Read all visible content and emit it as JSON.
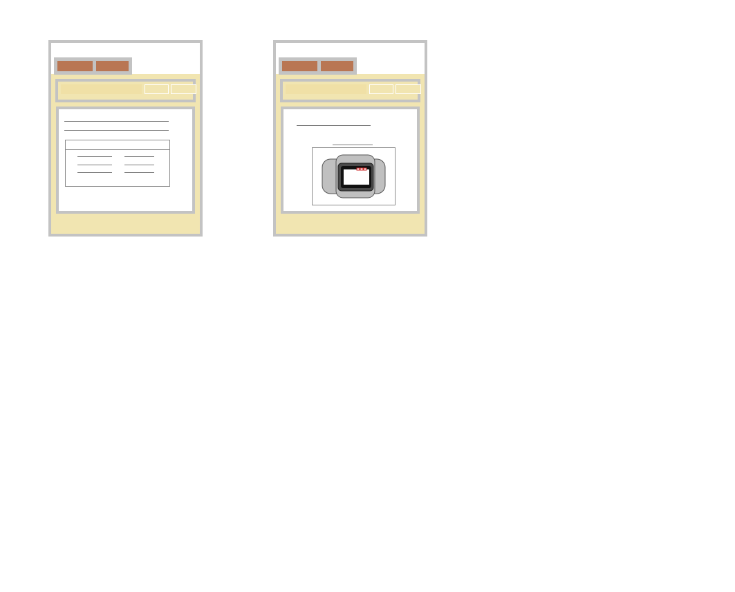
{
  "figure": {
    "left_panel": {
      "tabs": [
        "",
        ""
      ],
      "toolbar": {
        "field": "",
        "boxes": [
          "",
          ""
        ]
      },
      "content": {
        "text_lines": 2,
        "table": {
          "header_rows": 1,
          "rows": 3,
          "columns": 2
        }
      }
    },
    "right_panel": {
      "tabs": [
        "",
        ""
      ],
      "toolbar": {
        "field": "",
        "boxes": [
          "",
          ""
        ]
      },
      "content": {
        "text_lines": 2,
        "device_illustration": {
          "controls_color": "#cc2222",
          "controls_count": 3
        }
      }
    },
    "colors": {
      "frame_gray": "#c3c3c3",
      "panel_tan": "#f1e5b1",
      "tab_brown": "#b97653",
      "device_gray": "#c0c0c0",
      "device_dark": "#4a4a4a"
    }
  }
}
